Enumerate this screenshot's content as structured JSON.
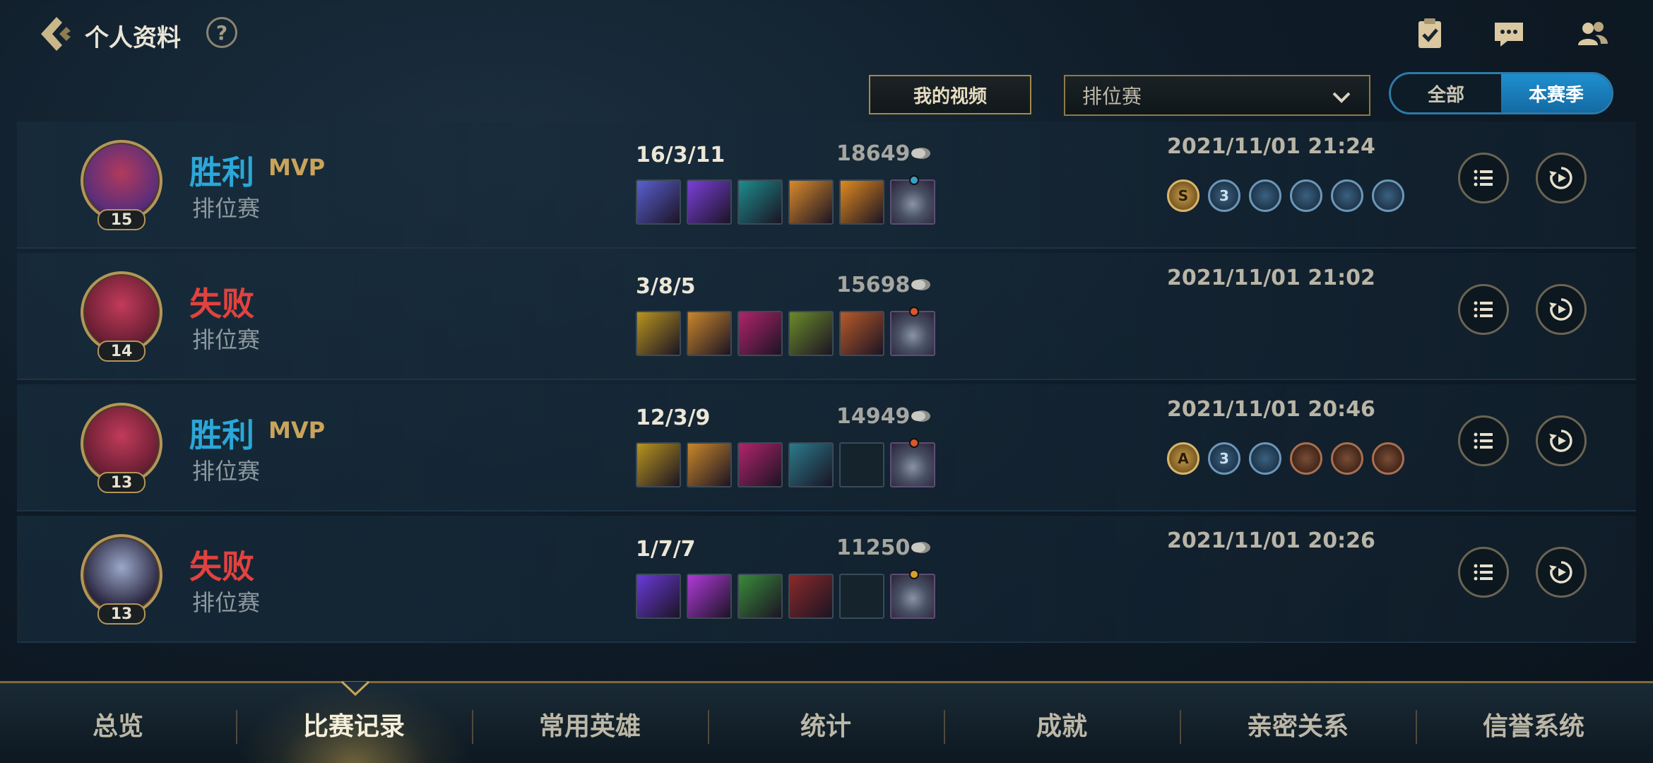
{
  "header": {
    "title": "个人资料",
    "help_label": "?"
  },
  "filters": {
    "video_button": "我的视频",
    "mode_selected": "排位赛",
    "season_options": [
      "全部",
      "本赛季"
    ],
    "season_active": "本赛季"
  },
  "matches": [
    {
      "result": "胜利",
      "result_type": "win",
      "mvp": "MVP",
      "mode": "排位赛",
      "level": "15",
      "kda": "16/3/11",
      "gold": "18649",
      "datetime": "2021/11/01 21:24",
      "avatar_colors": [
        "#5a2e7a",
        "#b23a5c"
      ],
      "items": [
        "#5b5fd0",
        "#7a3fd8",
        "#1d8c8c",
        "#d88a2a",
        "#e08a1e",
        "trinket"
      ],
      "trinket_pip": "#39a0c8",
      "badges": [
        {
          "type": "gold",
          "text": "S"
        },
        {
          "type": "blue",
          "text": "3"
        },
        {
          "type": "blue",
          "text": ""
        },
        {
          "type": "blue",
          "text": ""
        },
        {
          "type": "blue",
          "text": ""
        },
        {
          "type": "blue",
          "text": ""
        }
      ]
    },
    {
      "result": "失败",
      "result_type": "loss",
      "mvp": "",
      "mode": "排位赛",
      "level": "14",
      "kda": "3/8/5",
      "gold": "15698",
      "datetime": "2021/11/01 21:02",
      "avatar_colors": [
        "#6b1f34",
        "#c23b5a"
      ],
      "items": [
        "#b8941e",
        "#c9862a",
        "#b0246a",
        "#6a8a2a",
        "#b85a2a",
        "trinket"
      ],
      "trinket_pip": "#d8582a",
      "badges": []
    },
    {
      "result": "胜利",
      "result_type": "win",
      "mvp": "MVP",
      "mode": "排位赛",
      "level": "13",
      "kda": "12/3/9",
      "gold": "14949",
      "datetime": "2021/11/01 20:46",
      "avatar_colors": [
        "#6b1f34",
        "#c23b5a"
      ],
      "items": [
        "#b8941e",
        "#c9862a",
        "#b0246a",
        "#2a7a8a",
        "empty",
        "trinket"
      ],
      "trinket_pip": "#d8582a",
      "badges": [
        {
          "type": "gold",
          "text": "A"
        },
        {
          "type": "blue",
          "text": "3"
        },
        {
          "type": "blue",
          "text": ""
        },
        {
          "type": "bronze",
          "text": ""
        },
        {
          "type": "bronze",
          "text": ""
        },
        {
          "type": "bronze",
          "text": ""
        }
      ]
    },
    {
      "result": "失败",
      "result_type": "loss",
      "mvp": "",
      "mode": "排位赛",
      "level": "13",
      "kda": "1/7/7",
      "gold": "11250",
      "datetime": "2021/11/01 20:26",
      "avatar_colors": [
        "#2d2a44",
        "#9aa8c8"
      ],
      "items": [
        "#6a3ad8",
        "#b03ad8",
        "#3a8a3a",
        "#8a2a2a",
        "empty",
        "trinket"
      ],
      "trinket_pip": "#d8a02a",
      "badges": []
    }
  ],
  "tabs": [
    "总览",
    "比赛记录",
    "常用英雄",
    "统计",
    "成就",
    "亲密关系",
    "信誉系统"
  ],
  "active_tab": "比赛记录",
  "icons": {
    "back": "back-chevron-icon",
    "clipboard": "clipboard-check-icon",
    "chat": "chat-bubble-icon",
    "friends": "friends-icon",
    "details": "list-icon",
    "replay": "replay-icon",
    "gold": "gold-coin-icon"
  },
  "colors": {
    "win": "#2ba7d8",
    "loss": "#e2423f",
    "accent_gold": "#b4955a",
    "accent_blue": "#1f8fcf"
  }
}
